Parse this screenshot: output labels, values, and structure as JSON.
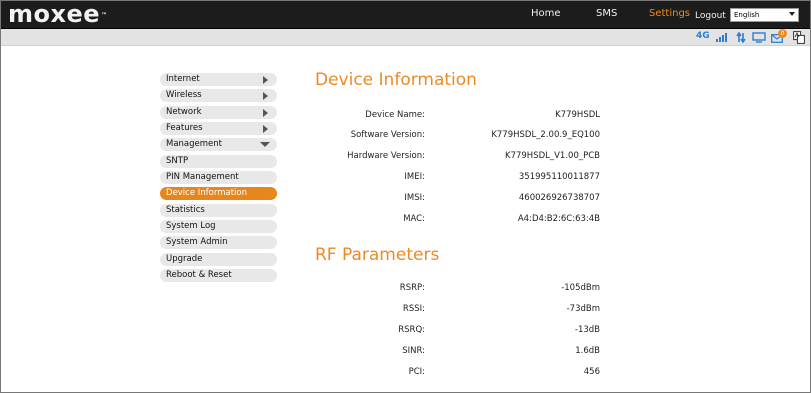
{
  "header": {
    "logo": "moxee",
    "trademark": "™",
    "nav": [
      "Home",
      "SMS",
      "Settings"
    ],
    "logout": "Logout",
    "language_selected": "English",
    "accent_color": "#f08a1c"
  },
  "status": {
    "network": "4G",
    "sms_count": "0",
    "icons": [
      "signal-icon",
      "data-transfer-icon",
      "computer-icon",
      "message-icon",
      "language-icon"
    ]
  },
  "menu": {
    "items": [
      "Internet",
      "Wireless",
      "Network",
      "Features",
      "Management"
    ],
    "sub_items": [
      "SNTP",
      "PIN Management",
      "Device Information",
      "Statistics",
      "System Log",
      "System Admin",
      "Upgrade",
      "Reboot & Reset"
    ],
    "active": "Device Information"
  },
  "device_info": {
    "title": "Device Information",
    "rows": [
      {
        "label": "Device Name:",
        "value": "K779HSDL"
      },
      {
        "label": "Software Version:",
        "value": "K779HSDL_2.00.9_EQ100"
      },
      {
        "label": "Hardware Version:",
        "value": "K779HSDL_V1.00_PCB"
      },
      {
        "label": "IMEI:",
        "value": "351995110011877"
      },
      {
        "label": "IMSI:",
        "value": "460026926738707"
      },
      {
        "label": "MAC:",
        "value": "A4:D4:B2:6C:63:4B"
      }
    ]
  },
  "rf_parameters": {
    "title": "RF Parameters",
    "rows": [
      {
        "label": "RSRP:",
        "value": "-105dBm"
      },
      {
        "label": "RSSI:",
        "value": "-73dBm"
      },
      {
        "label": "RSRQ:",
        "value": "-13dB"
      },
      {
        "label": "SINR:",
        "value": "1.6dB"
      },
      {
        "label": "PCI:",
        "value": "456"
      }
    ]
  }
}
